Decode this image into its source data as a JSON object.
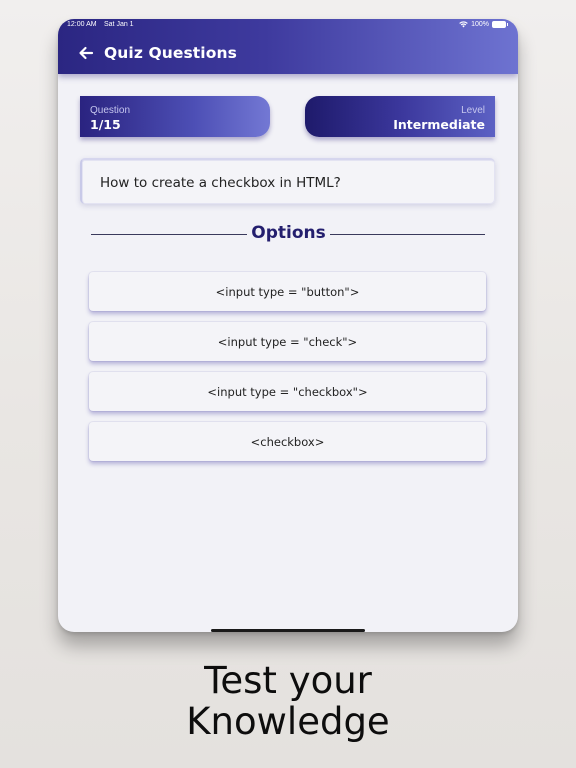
{
  "status_bar": {
    "time": "12:00 AM",
    "date": "Sat Jan 1",
    "battery": "100%"
  },
  "appbar": {
    "title": "Quiz Questions",
    "back_icon": "arrow-left-icon"
  },
  "question_card": {
    "label": "Question",
    "value": "1/15"
  },
  "level_card": {
    "label": "Level",
    "value": "Intermediate"
  },
  "question": {
    "text": "How to create a checkbox in HTML?"
  },
  "options_section": {
    "title": "Options",
    "items": [
      {
        "label": "<input type = \"button\">"
      },
      {
        "label": "<input type = \"check\">"
      },
      {
        "label": "<input type = \"checkbox\">"
      },
      {
        "label": "<checkbox>"
      }
    ]
  },
  "caption": {
    "line1": "Test your",
    "line2": "Knowledge"
  },
  "colors": {
    "primary": "#2b2682",
    "accent": "#6e73d1",
    "background": "#f2f2f7"
  }
}
